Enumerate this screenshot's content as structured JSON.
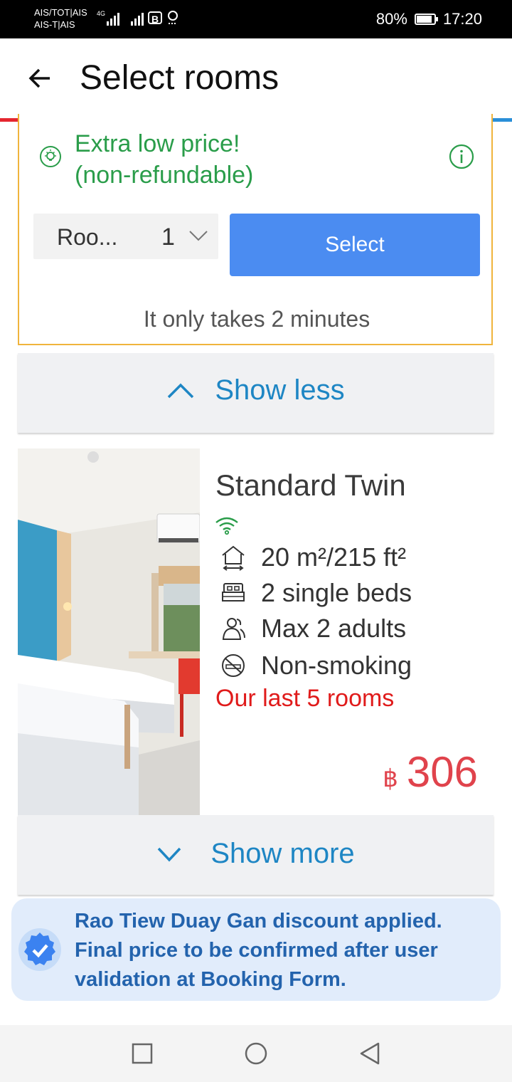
{
  "status_bar": {
    "carrier_line1": "AIS/TOT|AIS",
    "carrier_line2": "AIS-T|AIS",
    "network": "4G",
    "badge": "B",
    "battery": "80%",
    "time": "17:20"
  },
  "app_bar": {
    "title": "Select rooms",
    "back_icon": "arrow-left-icon"
  },
  "rainbow_colors": [
    "#e5262f",
    "#f2a51f",
    "#2bab4a",
    "#8c3fbd",
    "#2a8fd8"
  ],
  "offer": {
    "line1": "Extra low price!",
    "line2": "(non-refundable)",
    "room_label": "Roo...",
    "room_count": "1",
    "select_label": "Select",
    "takes_text": "It only takes 2 minutes"
  },
  "show_less": {
    "label": "Show less"
  },
  "room": {
    "name": "Standard Twin",
    "size": "20 m²/215 ft²",
    "beds": "2 single beds",
    "occupancy": "Max 2 adults",
    "smoking": "Non-smoking",
    "availability": "Our last 5 rooms",
    "currency": "฿",
    "price": "306"
  },
  "show_more": {
    "label": "Show more"
  },
  "discount": {
    "text": "Rao Tiew Duay Gan discount applied. Final price to be confirmed after user validation at Booking Form."
  },
  "colors": {
    "accent_blue": "#4b8cf1",
    "link_blue": "#1e86c4",
    "offer_green": "#2a9d4a",
    "price_red": "#e0434c",
    "warning_red": "#e01b1b",
    "border_orange": "#f0b43c"
  }
}
